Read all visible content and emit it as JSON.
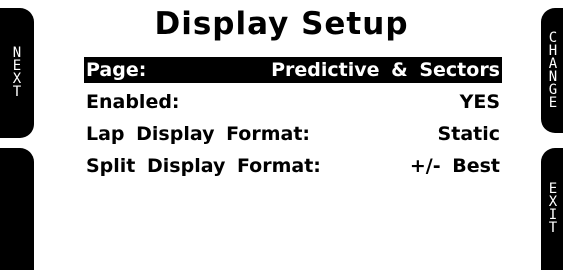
{
  "title": "Display Setup",
  "softkeys": {
    "left_top": "NEXT",
    "left_bottom": "",
    "right_top": "CHANGE",
    "right_bottom": "EXIT"
  },
  "settings": [
    {
      "label": "Page:",
      "value": "Predictive & Sectors",
      "selected": true
    },
    {
      "label": "Enabled:",
      "value": "YES",
      "selected": false
    },
    {
      "label": "Lap Display Format:",
      "value": "Static",
      "selected": false
    },
    {
      "label": "Split Display Format:",
      "value": "+/- Best",
      "selected": false
    }
  ]
}
